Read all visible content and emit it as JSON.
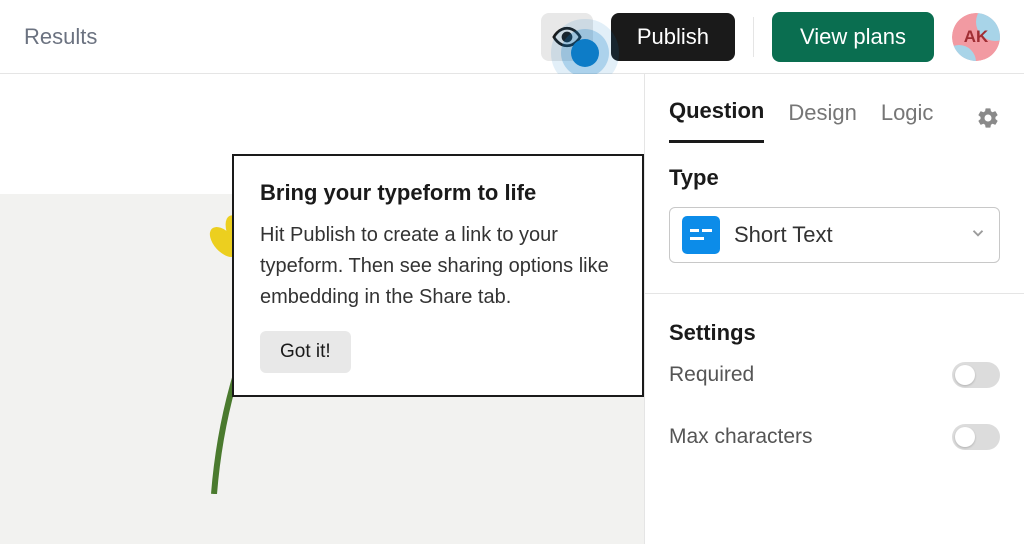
{
  "header": {
    "results_label": "Results",
    "publish_label": "Publish",
    "view_plans_label": "View plans",
    "avatar_initials": "AK"
  },
  "tooltip": {
    "title": "Bring your typeform to life",
    "body": "Hit Publish to create a link to your typeform. Then see sharing options like embedding in the Share tab.",
    "cta_label": "Got it!"
  },
  "sidepanel": {
    "tabs": [
      "Question",
      "Design",
      "Logic"
    ],
    "active_tab": "Question",
    "type_label": "Type",
    "type_value": "Short Text",
    "settings_label": "Settings",
    "settings": [
      {
        "label": "Required",
        "on": false
      },
      {
        "label": "Max characters",
        "on": false
      }
    ]
  }
}
